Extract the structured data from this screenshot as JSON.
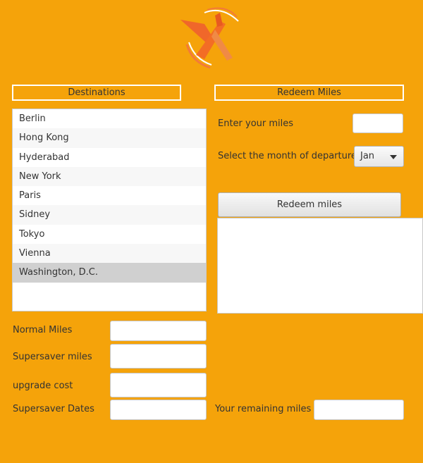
{
  "colors": {
    "background": "#f5a30a",
    "selected_row": "#d0d0d0"
  },
  "logo": {
    "icon": "airplane-logo-icon"
  },
  "destinations": {
    "header": "Destinations",
    "items": [
      "Berlin",
      "Hong Kong",
      "Hyderabad",
      "New York",
      "Paris",
      "Sidney",
      "Tokyo",
      "Vienna",
      "Washington, D.C."
    ],
    "selected": "Washington, D.C."
  },
  "redeem": {
    "header": "Redeem Miles",
    "miles_label": "Enter your miles",
    "miles_value": "",
    "month_label": "Select the month of departure",
    "month_value": "Jan",
    "button_label": "Redeem miles",
    "output_text": "",
    "remaining_label": "Your remaining miles",
    "remaining_value": ""
  },
  "details": {
    "normal_label": "Normal Miles",
    "normal_value": "",
    "supersaver_label": "Supersaver miles",
    "supersaver_value": "",
    "upgrade_label": "upgrade cost",
    "upgrade_value": "",
    "dates_label": "Supersaver Dates",
    "dates_value": ""
  }
}
